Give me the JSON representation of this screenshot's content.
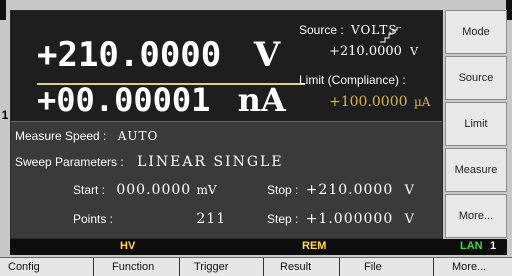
{
  "display": {
    "voltage_value": "+210.0000",
    "voltage_unit": "V",
    "current_value": "+00.00001",
    "current_unit": "nA",
    "source_label": "Source :",
    "source_mode": "VOLTS",
    "source_value": "+210.0000",
    "source_unit": "V",
    "limit_label": "Limit (Compliance) :",
    "limit_value": "+100.0000",
    "limit_unit": "µA",
    "channel": "1"
  },
  "settings": {
    "measure_speed_label": "Measure Speed :",
    "measure_speed_value": "AUTO",
    "sweep_label": "Sweep Parameters :",
    "sweep_value": "LINEAR SINGLE",
    "start_label": "Start :",
    "start_value": "000.0000",
    "start_unit": "mV",
    "stop_label": "Stop :",
    "stop_value": "+210.0000",
    "stop_unit": "V",
    "points_label": "Points :",
    "points_value": "211",
    "step_label": "Step :",
    "step_value": "+1.000000",
    "step_unit": "V"
  },
  "softkeys": [
    "Mode",
    "Source",
    "Limit",
    "Measure",
    "More..."
  ],
  "status": {
    "hv": "HV",
    "rem": "REM",
    "lan": "LAN",
    "lan_num": "1"
  },
  "function_keys": [
    "Config",
    "Function",
    "Trigger",
    "Result",
    "File",
    "More..."
  ],
  "colors": {
    "limit": "#d9b34a",
    "status_text": "#ffdc3c"
  }
}
